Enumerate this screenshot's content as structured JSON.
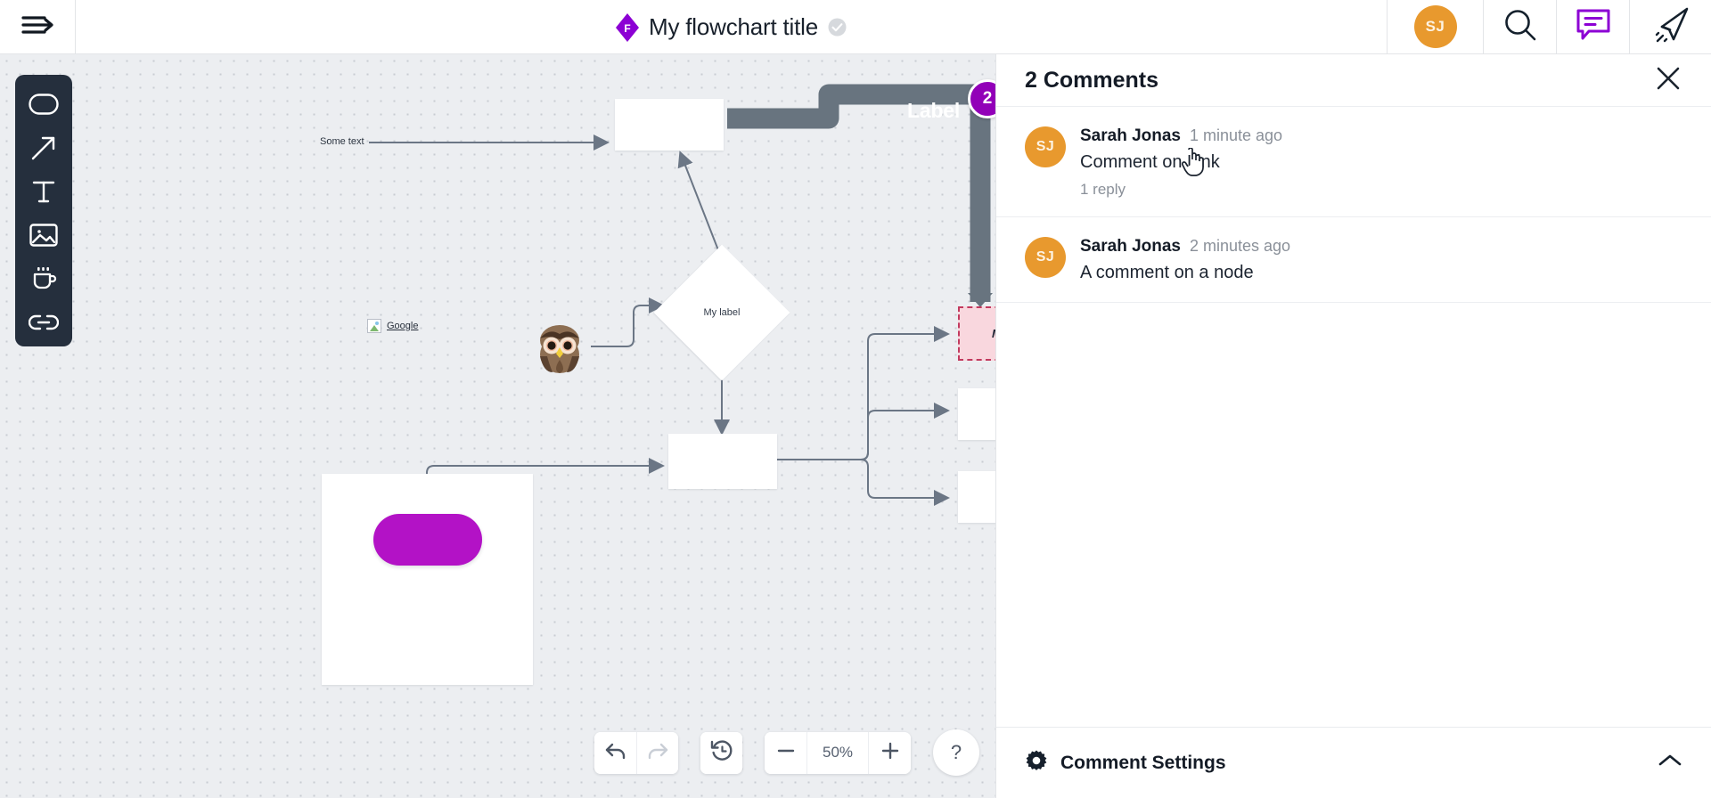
{
  "header": {
    "menu_icon": "hamburger-menu-icon",
    "brand_icon": "flowchart-logo-diamond-icon",
    "title": "My flowchart title",
    "saved_icon": "saved-check-icon",
    "avatar_initials": "SJ",
    "avatar_color": "#e8992e",
    "search_icon": "search-icon",
    "comments_icon": "comment-icon",
    "comments_icon_color": "#8a00d4",
    "share_icon": "send-share-icon"
  },
  "toolbar": {
    "items": [
      {
        "icon": "rounded-rectangle-shape-icon",
        "name": "shape-tool"
      },
      {
        "icon": "arrow-icon",
        "name": "arrow-tool"
      },
      {
        "icon": "text-icon",
        "name": "text-tool"
      },
      {
        "icon": "image-icon",
        "name": "image-tool"
      },
      {
        "icon": "coffee-cup-icon",
        "name": "coffee-tool"
      },
      {
        "icon": "link-chain-icon",
        "name": "link-tool"
      }
    ]
  },
  "canvas": {
    "background_color": "#eceef1",
    "texts": {
      "some_text": "Some text",
      "my_label": "My label",
      "edge_label": "Label",
      "google_link": "Google",
      "pink_node_text": "M"
    },
    "comment_pin_count": "2",
    "node_colors": {
      "pink_fill": "#f9d7de",
      "pink_border": "#c23a5e",
      "purple_pill": "#b312c6",
      "edge_gray": "#667283",
      "pin_purple": "#9200b8"
    }
  },
  "bottom_controls": {
    "undo_icon": "undo-arrow-icon",
    "redo_icon": "redo-arrow-icon",
    "history_icon": "history-clock-icon",
    "zoom_out_icon": "minus-icon",
    "zoom_level": "50%",
    "zoom_in_icon": "plus-icon",
    "help_label": "?"
  },
  "comments_panel": {
    "title": "2 Comments",
    "close_icon": "close-x-icon",
    "comments": [
      {
        "avatar": "SJ",
        "author": "Sarah Jonas",
        "time": "1 minute ago",
        "text": "Comment on Link",
        "replies": "1 reply"
      },
      {
        "avatar": "SJ",
        "author": "Sarah Jonas",
        "time": "2 minutes ago",
        "text": "A comment on a node",
        "replies": ""
      }
    ],
    "footer": {
      "icon": "gear-icon",
      "label": "Comment Settings",
      "chevron": "chevron-up-icon"
    }
  }
}
